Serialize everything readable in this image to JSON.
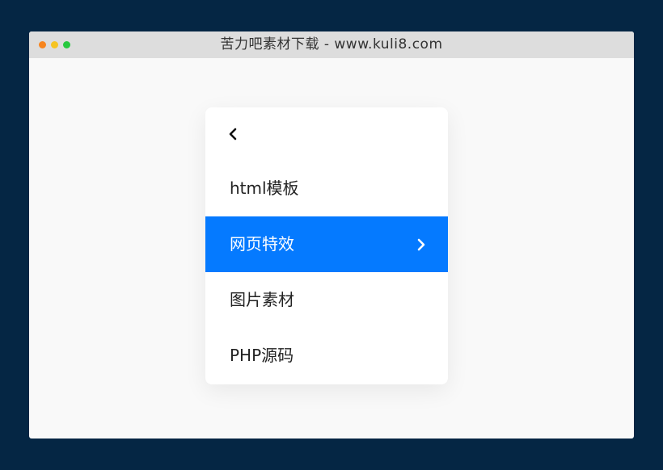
{
  "window": {
    "title": "苦力吧素材下载 - www.kuli8.com",
    "controls": {
      "close_color": "#f7851e",
      "minimize_color": "#f5c423",
      "maximize_color": "#27c93f"
    }
  },
  "menu": {
    "back_icon": "chevron-left-icon",
    "accent_color": "#057aff",
    "items": [
      {
        "label": "html模板",
        "active": false,
        "has_submenu": false
      },
      {
        "label": "网页特效",
        "active": true,
        "has_submenu": true,
        "icon": "chevron-right-icon"
      },
      {
        "label": "图片素材",
        "active": false,
        "has_submenu": false
      },
      {
        "label": "PHP源码",
        "active": false,
        "has_submenu": false
      }
    ]
  }
}
